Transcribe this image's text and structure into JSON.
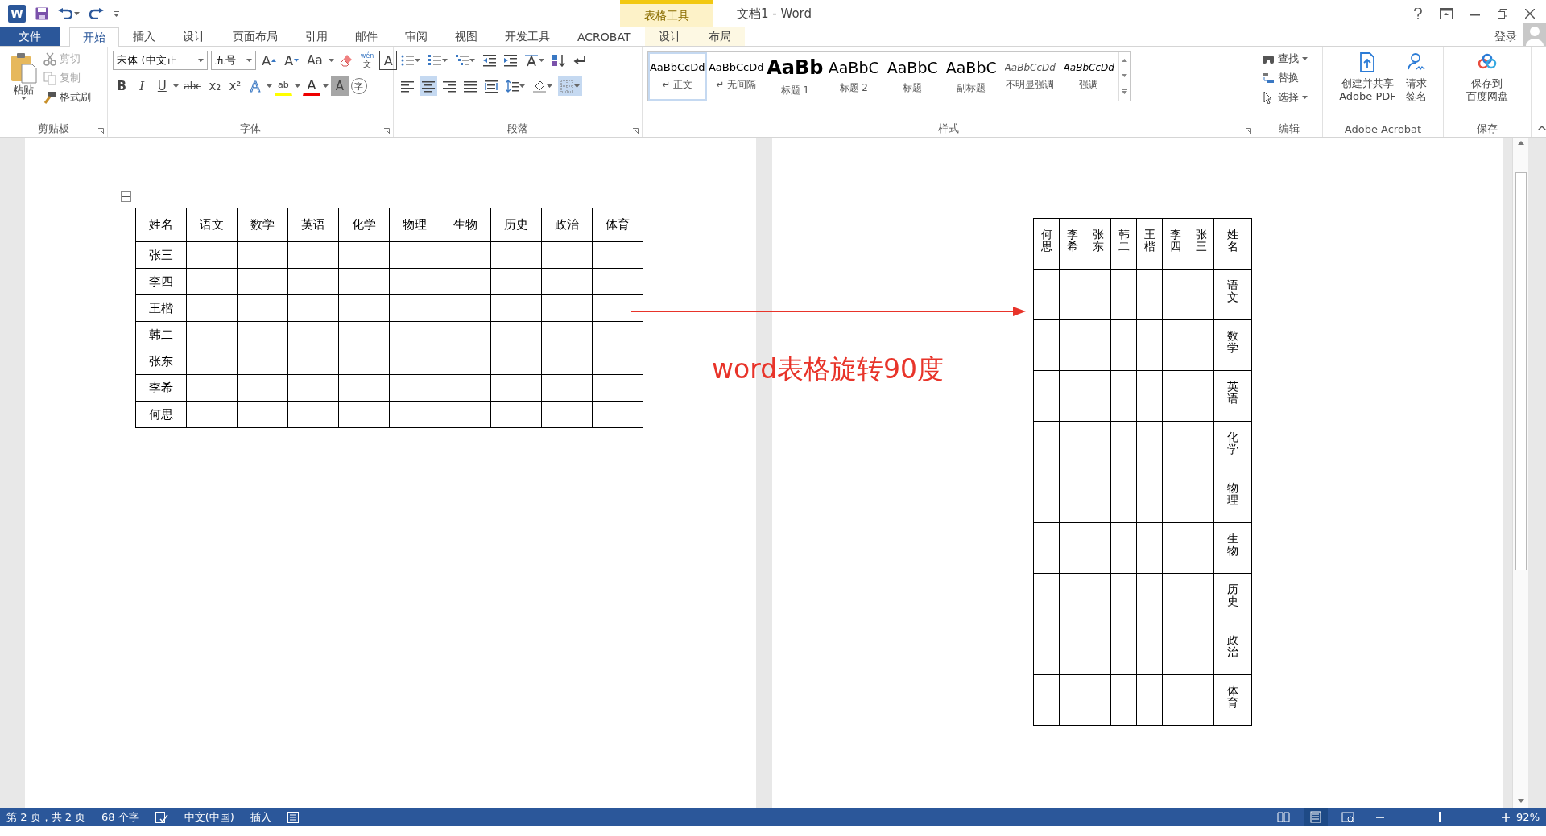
{
  "title_bar": {
    "app_glyph": "W",
    "title": "文档1 - Word",
    "context_group": "表格工具",
    "account": "登录"
  },
  "tabs": [
    {
      "label": "文件",
      "kind": "file",
      "selected": false
    },
    {
      "label": "开始",
      "kind": "main",
      "selected": true
    },
    {
      "label": "插入",
      "kind": "main",
      "selected": false
    },
    {
      "label": "设计",
      "kind": "main",
      "selected": false
    },
    {
      "label": "页面布局",
      "kind": "main",
      "selected": false
    },
    {
      "label": "引用",
      "kind": "main",
      "selected": false
    },
    {
      "label": "邮件",
      "kind": "main",
      "selected": false
    },
    {
      "label": "审阅",
      "kind": "main",
      "selected": false
    },
    {
      "label": "视图",
      "kind": "main",
      "selected": false
    },
    {
      "label": "开发工具",
      "kind": "main",
      "selected": false
    },
    {
      "label": "ACROBAT",
      "kind": "main",
      "selected": false
    },
    {
      "label": "设计",
      "kind": "context",
      "selected": false
    },
    {
      "label": "布局",
      "kind": "context",
      "selected": false
    }
  ],
  "clipboard": {
    "label": "剪贴板",
    "paste": "粘贴",
    "items": [
      {
        "label": "剪切",
        "kind": "cut",
        "disabled": true
      },
      {
        "label": "复制",
        "kind": "copy",
        "disabled": true
      },
      {
        "label": "格式刷",
        "kind": "painter",
        "disabled": false
      }
    ]
  },
  "font": {
    "label": "字体",
    "font_name": "宋体 (中文正",
    "font_size": "五号",
    "row1": [
      {
        "kind": "grow",
        "glyph": "A"
      },
      {
        "kind": "shrink",
        "glyph": "A"
      },
      {
        "kind": "case",
        "glyph": "Aa"
      },
      {
        "kind": "clear"
      },
      {
        "kind": "phonetic",
        "glyph": "文",
        "ruby": "wén"
      },
      {
        "kind": "border",
        "glyph": "A"
      }
    ],
    "row2": [
      {
        "kind": "bold",
        "glyph": "B"
      },
      {
        "kind": "italic",
        "glyph": "I"
      },
      {
        "kind": "underline",
        "glyph": "U"
      },
      {
        "kind": "strike",
        "glyph": "abc"
      },
      {
        "kind": "sub",
        "glyph": "x₂"
      },
      {
        "kind": "sup",
        "glyph": "x²"
      },
      {
        "kind": "effects",
        "glyph": "A"
      },
      {
        "kind": "highlight",
        "glyph": "ab"
      },
      {
        "kind": "color",
        "glyph": "A"
      },
      {
        "kind": "shading",
        "glyph": "A"
      },
      {
        "kind": "enclose",
        "glyph": "字"
      }
    ]
  },
  "paragraph": {
    "label": "段落",
    "row1": [
      {
        "kind": "bullets",
        "selected": false
      },
      {
        "kind": "numbering",
        "selected": false
      },
      {
        "kind": "multilevel",
        "selected": false
      },
      {
        "kind": "outdent",
        "selected": false
      },
      {
        "kind": "indent",
        "selected": false
      },
      {
        "kind": "asian",
        "selected": false
      },
      {
        "kind": "sort",
        "selected": false
      },
      {
        "kind": "marks",
        "selected": false
      }
    ],
    "row2": [
      {
        "kind": "left",
        "selected": false
      },
      {
        "kind": "center",
        "selected": true
      },
      {
        "kind": "right",
        "selected": false
      },
      {
        "kind": "justify",
        "selected": false
      },
      {
        "kind": "distribute",
        "selected": false
      },
      {
        "kind": "spacing",
        "selected": false
      },
      {
        "kind": "shade",
        "selected": false
      },
      {
        "kind": "borders",
        "selected": true
      }
    ]
  },
  "styles": {
    "label": "样式",
    "items": [
      {
        "preview": "AaBbCcDd",
        "name": "↵ 正文",
        "kind": "normal",
        "selected": true
      },
      {
        "preview": "AaBbCcDd",
        "name": "↵ 无间隔",
        "kind": "normal",
        "selected": false
      },
      {
        "preview": "AaBb",
        "name": "标题 1",
        "kind": "h1",
        "selected": false
      },
      {
        "preview": "AaBbC",
        "name": "标题 2",
        "kind": "h2",
        "selected": false
      },
      {
        "preview": "AaBbC",
        "name": "标题",
        "kind": "h2",
        "selected": false
      },
      {
        "preview": "AaBbC",
        "name": "副标题",
        "kind": "h2",
        "selected": false
      },
      {
        "preview": "AaBbCcDd",
        "name": "不明显强调",
        "kind": "subtle",
        "selected": false
      },
      {
        "preview": "AaBbCcDd",
        "name": "强调",
        "kind": "emph",
        "selected": false
      }
    ]
  },
  "editing": {
    "label": "编辑",
    "items": [
      {
        "label": "查找",
        "kind": "find"
      },
      {
        "label": "替换",
        "kind": "replace"
      },
      {
        "label": "选择",
        "kind": "select"
      }
    ]
  },
  "acrobat": {
    "label": "Adobe Acrobat",
    "items": [
      {
        "lines": [
          "创建并共享",
          "Adobe PDF"
        ],
        "kind": "pdf"
      },
      {
        "lines": [
          "请求",
          "签名"
        ],
        "kind": "sign"
      }
    ]
  },
  "save": {
    "label": "保存",
    "items": [
      {
        "lines": [
          "保存到",
          "百度网盘"
        ],
        "kind": "cloud"
      }
    ]
  },
  "table": {
    "columns": [
      "姓名",
      "语文",
      "数学",
      "英语",
      "化学",
      "物理",
      "生物",
      "历史",
      "政治",
      "体育"
    ],
    "rows": [
      "张三",
      "李四",
      "王楷",
      "韩二",
      "张东",
      "李希",
      "何思"
    ]
  },
  "annotation": "word表格旋转90度",
  "rotated_table": {
    "header": [
      "何思",
      "李希",
      "张东",
      "韩二",
      "王楷",
      "李四",
      "张三",
      "姓名"
    ],
    "row_labels": [
      "语文",
      "数学",
      "英语",
      "化学",
      "物理",
      "生物",
      "历史",
      "政治",
      "体育"
    ]
  },
  "status_bar": {
    "page": "第 2 页，共 2 页",
    "words": "68 个字",
    "language": "中文(中国)",
    "mode": "插入",
    "views": [
      {
        "kind": "read",
        "selected": false
      },
      {
        "kind": "print",
        "selected": true
      },
      {
        "kind": "web",
        "selected": false
      }
    ],
    "zoom": {
      "level": 0.46,
      "reading": "92%"
    }
  }
}
